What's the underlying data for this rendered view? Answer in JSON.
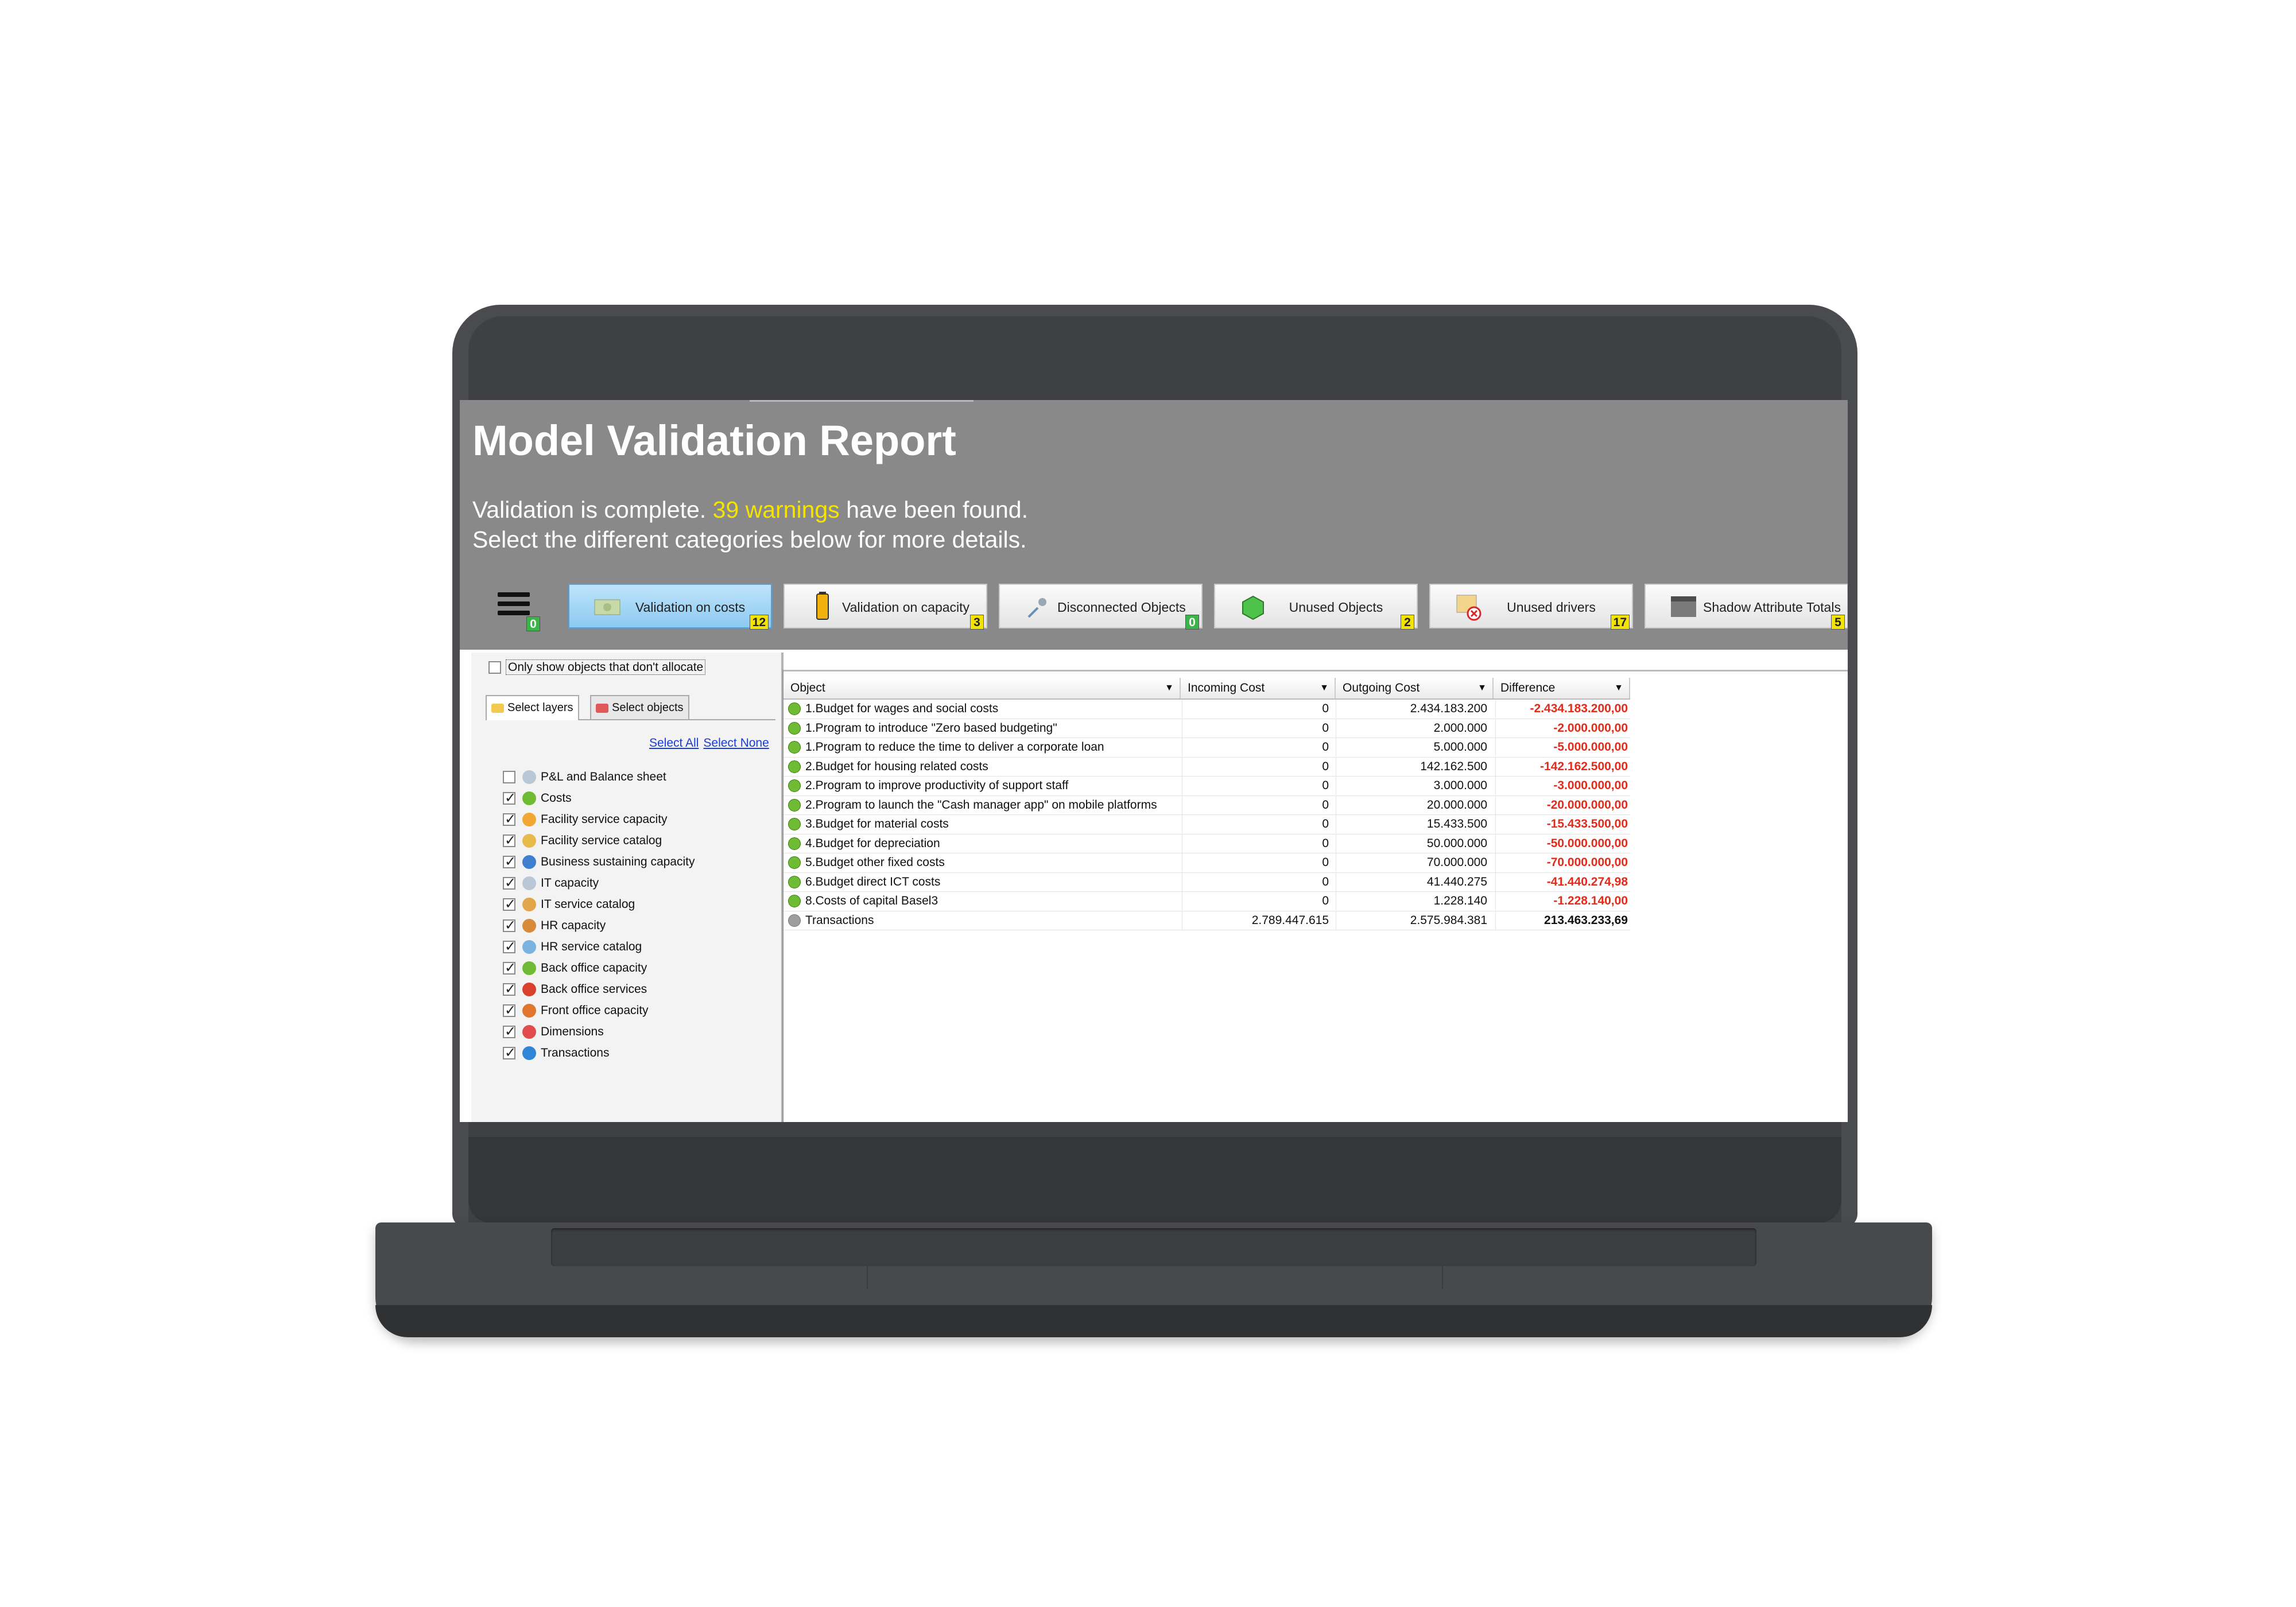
{
  "header": {
    "title": "Model Validation Report",
    "message_prefix": "Validation is complete.",
    "warnings_text": "39 warnings",
    "message_suffix": "have been found.",
    "message_line2": "Select the different categories below for more details."
  },
  "menu_badge": "0",
  "categories": [
    {
      "label": "Validation on costs",
      "count": "12",
      "active": true
    },
    {
      "label": "Validation on capacity",
      "count": "3"
    },
    {
      "label": "Disconnected Objects",
      "count": "0"
    },
    {
      "label": "Unused Objects",
      "count": "2"
    },
    {
      "label": "Unused drivers",
      "count": "17"
    },
    {
      "label": "Shadow Attribute Totals",
      "count": "5"
    }
  ],
  "left_panel": {
    "only_show_label": "Only show objects that don't allocate",
    "tabs": [
      "Select layers",
      "Select objects"
    ],
    "select_all": "Select All",
    "select_none": "Select None",
    "layers": [
      {
        "label": "P&L and Balance sheet",
        "checked": false
      },
      {
        "label": "Costs",
        "checked": true
      },
      {
        "label": "Facility service capacity",
        "checked": true
      },
      {
        "label": "Facility service catalog",
        "checked": true
      },
      {
        "label": "Business sustaining capacity",
        "checked": true
      },
      {
        "label": "IT capacity",
        "checked": true
      },
      {
        "label": "IT service catalog",
        "checked": true
      },
      {
        "label": "HR capacity",
        "checked": true
      },
      {
        "label": "HR service catalog",
        "checked": true
      },
      {
        "label": "Back office capacity",
        "checked": true
      },
      {
        "label": "Back office services",
        "checked": true
      },
      {
        "label": "Front office capacity",
        "checked": true
      },
      {
        "label": "Dimensions",
        "checked": true
      },
      {
        "label": "Transactions",
        "checked": true
      }
    ]
  },
  "grid": {
    "columns": [
      "Object",
      "Incoming Cost",
      "Outgoing Cost",
      "Difference"
    ],
    "rows": [
      {
        "object": "1.Budget for wages and social costs",
        "incoming": "0",
        "outgoing": "2.434.183.200",
        "difference": "-2.434.183.200,00"
      },
      {
        "object": "1.Program to introduce \"Zero based budgeting\"",
        "incoming": "0",
        "outgoing": "2.000.000",
        "difference": "-2.000.000,00"
      },
      {
        "object": "1.Program to reduce the time to deliver a corporate loan",
        "incoming": "0",
        "outgoing": "5.000.000",
        "difference": "-5.000.000,00"
      },
      {
        "object": "2.Budget for housing related costs",
        "incoming": "0",
        "outgoing": "142.162.500",
        "difference": "-142.162.500,00"
      },
      {
        "object": "2.Program to improve productivity of support staff",
        "incoming": "0",
        "outgoing": "3.000.000",
        "difference": "-3.000.000,00"
      },
      {
        "object": "2.Program to launch the \"Cash manager app\" on mobile platforms",
        "incoming": "0",
        "outgoing": "20.000.000",
        "difference": "-20.000.000,00"
      },
      {
        "object": "3.Budget for material costs",
        "incoming": "0",
        "outgoing": "15.433.500",
        "difference": "-15.433.500,00"
      },
      {
        "object": "4.Budget for depreciation",
        "incoming": "0",
        "outgoing": "50.000.000",
        "difference": "-50.000.000,00"
      },
      {
        "object": "5.Budget other fixed costs",
        "incoming": "0",
        "outgoing": "70.000.000",
        "difference": "-70.000.000,00"
      },
      {
        "object": "6.Budget direct ICT costs",
        "incoming": "0",
        "outgoing": "41.440.275",
        "difference": "-41.440.274,98"
      },
      {
        "object": "8.Costs of capital Basel3",
        "incoming": "0",
        "outgoing": "1.228.140",
        "difference": "-1.228.140,00"
      },
      {
        "object": "Transactions",
        "incoming": "2.789.447.615",
        "outgoing": "2.575.984.381",
        "difference": "213.463.233,69"
      }
    ]
  }
}
